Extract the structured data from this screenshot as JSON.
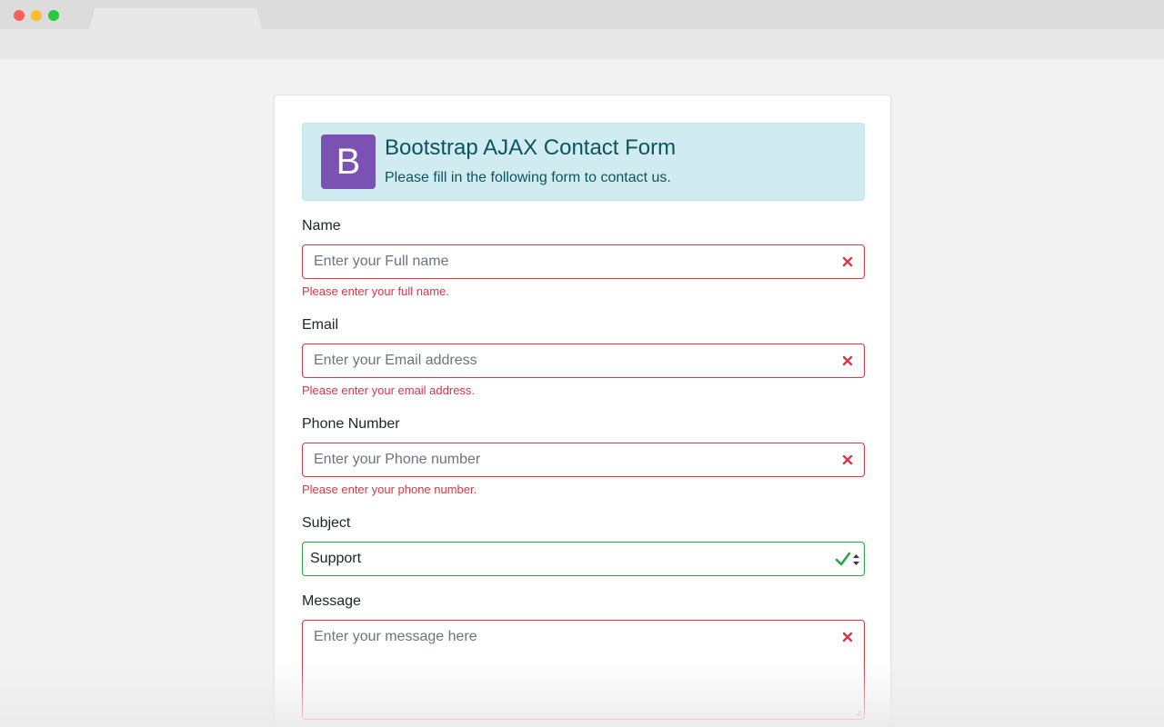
{
  "browser": {
    "controls": [
      "close",
      "minimize",
      "maximize"
    ]
  },
  "header": {
    "logo_letter": "B",
    "title": "Bootstrap AJAX Contact Form",
    "subtitle": "Please fill in the following form to contact us.",
    "logo_color": "#7952b3",
    "alert_bg": "#d1ecf1"
  },
  "form": {
    "name": {
      "label": "Name",
      "placeholder": "Enter your Full name",
      "error": "Please enter your full name."
    },
    "email": {
      "label": "Email",
      "placeholder": "Enter your Email address",
      "error": "Please enter your email address."
    },
    "phone": {
      "label": "Phone Number",
      "placeholder": "Enter your Phone number",
      "error": "Please enter your phone number."
    },
    "subject": {
      "label": "Subject",
      "selected": "Support"
    },
    "message": {
      "label": "Message",
      "placeholder": "Enter your message here"
    }
  },
  "colors": {
    "invalid": "#dc3545",
    "valid": "#28a745"
  },
  "icons": {
    "invalid": "close-icon",
    "valid": "check-icon",
    "select": "caret-updown-icon"
  }
}
